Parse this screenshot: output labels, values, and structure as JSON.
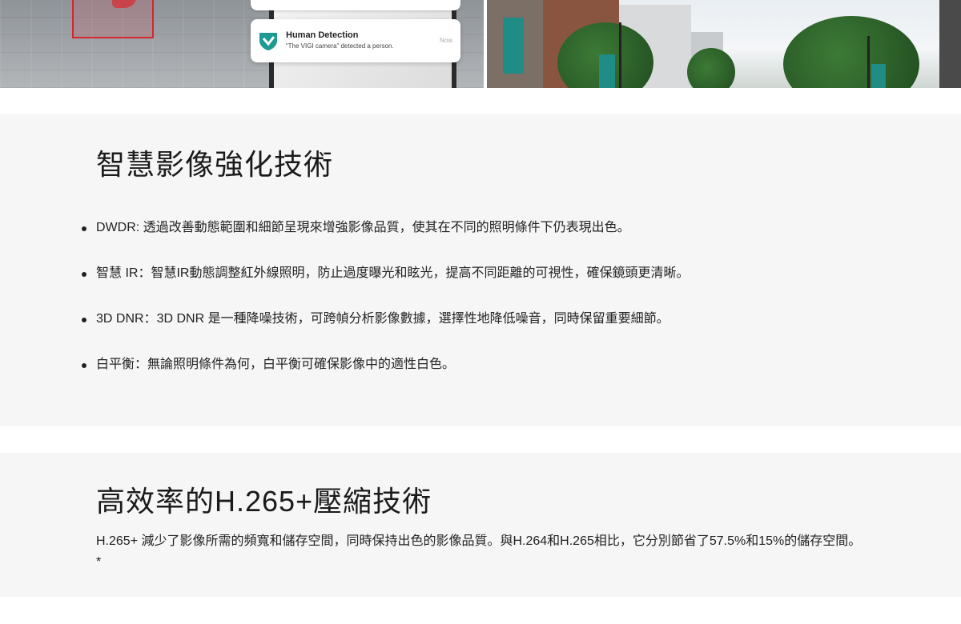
{
  "notification": {
    "title": "Human Detection",
    "body": "“The VIGI camera” detected a person.",
    "time": "Now"
  },
  "section1": {
    "title": "智慧影像強化技術",
    "features": [
      "DWDR: 透過改善動態範圍和細節呈現來增強影像品質，使其在不同的照明條件下仍表現出色。",
      "智慧 IR：智慧IR動態調整紅外線照明，防止過度曝光和眩光，提高不同距離的可視性，確保鏡頭更清晰。",
      "3D DNR：3D DNR 是一種降噪技術，可跨幀分析影像數據，選擇性地降低噪音，同時保留重要細節。",
      "白平衡：無論照明條件為何，白平衡可確保影像中的適性白色。"
    ]
  },
  "section2": {
    "title": "高效率的H.265+壓縮技術",
    "text": "H.265+ 減少了影像所需的頻寬和儲存空間，同時保持出色的影像品質。與H.264和H.265相比，它分別節省了57.5%和15%的儲存空間。*"
  },
  "colors": {
    "detection_box": "#d3262f",
    "brand_teal": "#1f8c86",
    "section_bg": "#f6f6f6"
  },
  "icons": {
    "notification": "vigi-shield-icon"
  }
}
